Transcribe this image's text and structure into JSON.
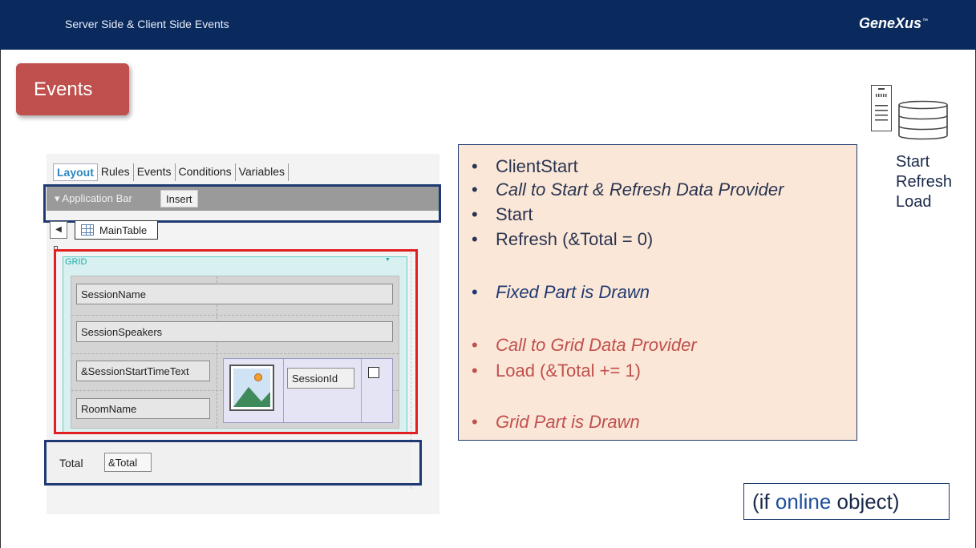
{
  "header": {
    "title": "Server Side & Client Side Events",
    "brand": "GeneXus",
    "brand_mark": "™"
  },
  "events_tag": {
    "label": "Events"
  },
  "ide": {
    "tabs": [
      "Layout",
      "Rules",
      "Events",
      "Conditions",
      "Variables"
    ],
    "active_tab": "Layout",
    "appbar": {
      "label": "▾  Application Bar",
      "insert": "Insert"
    },
    "maintable": "MainTable",
    "grid": {
      "header": "GRID",
      "fields": {
        "session_name": "SessionName",
        "session_speakers": "SessionSpeakers",
        "start_time": "&SessionStartTimeText",
        "room_name": "RoomName",
        "session_id": "SessionId"
      }
    },
    "total": {
      "label": "Total",
      "field": "&Total"
    }
  },
  "sequence": [
    {
      "text": "ClientStart",
      "style": "normal",
      "color": "#2a3550"
    },
    {
      "text": "Call to Start & Refresh Data Provider",
      "style": "italic",
      "color": "#2a3550"
    },
    {
      "text": "Start",
      "style": "normal",
      "color": "#2a3550"
    },
    {
      "text": "Refresh (&Total = 0)",
      "style": "normal",
      "color": "#2a3550"
    },
    {
      "text": "Fixed Part is Drawn",
      "style": "italic",
      "color": "#1f3a72"
    },
    {
      "text": "Call to Grid Data Provider",
      "style": "italic",
      "color": "#c0504d"
    },
    {
      "text": "Load (&Total += 1)",
      "style": "normal",
      "color": "#c0504d"
    },
    {
      "text": "Grid Part is Drawn",
      "style": "italic",
      "color": "#c0504d"
    }
  ],
  "side_labels": [
    "Start",
    "Refresh",
    "Load"
  ],
  "online_note": {
    "prefix": "(if ",
    "highlight": "online",
    "suffix": " object)"
  }
}
